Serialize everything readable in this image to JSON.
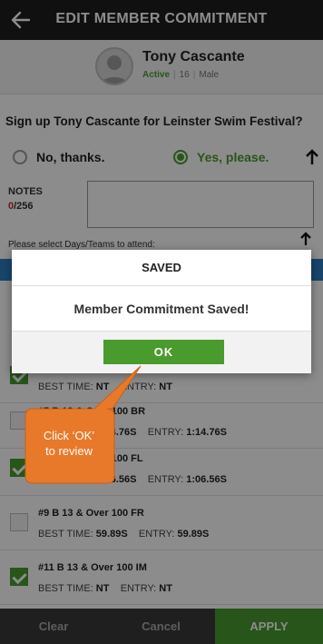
{
  "header": {
    "title": "EDIT MEMBER COMMITMENT"
  },
  "profile": {
    "name": "Tony Cascante",
    "status": "Active",
    "age": "16",
    "gender": "Male"
  },
  "question": "Sign up Tony Cascante for Leinster Swim Festival?",
  "options": {
    "no": "No, thanks.",
    "yes": "Yes, please."
  },
  "notes": {
    "label": "NOTES",
    "count_current": "0",
    "count_max": "/256"
  },
  "select_prompt": "Please select Days/Teams to attend:",
  "events": [
    {
      "title": "",
      "best_label": "BEST TIME:",
      "best": "NT",
      "entry_label": "ENTRY:",
      "entry": "NT",
      "checked": true
    },
    {
      "title": "#5   B   13 & Over   100 BR",
      "best_label": "BEST TIME:",
      "best": "1:14.76S",
      "entry_label": "ENTRY:",
      "entry": "1:14.76S",
      "checked": false
    },
    {
      "title": "#7   B   13 & Over   100 FL",
      "best_label": "BEST TIME:",
      "best": "1:06.56S",
      "entry_label": "ENTRY:",
      "entry": "1:06.56S",
      "checked": true
    },
    {
      "title": "#9   B   13 & Over   100 FR",
      "best_label": "BEST TIME:",
      "best": "59.89S",
      "entry_label": "ENTRY:",
      "entry": "59.89S",
      "checked": false
    },
    {
      "title": "#11   B   13 & Over   100 IM",
      "best_label": "BEST TIME:",
      "best": "NT",
      "entry_label": "ENTRY:",
      "entry": "NT",
      "checked": true
    }
  ],
  "footer": {
    "clear": "Clear",
    "cancel": "Cancel",
    "apply": "APPLY"
  },
  "modal": {
    "title": "SAVED",
    "message": "Member Commitment Saved!",
    "ok": "OK"
  },
  "callout": {
    "line1": "Click ‘OK’",
    "line2": "to review"
  },
  "colors": {
    "header": "#1e1e1e",
    "accent_green": "#4a9b2e",
    "accent_blue": "#2f7fc1",
    "callout": "#e8792a"
  }
}
